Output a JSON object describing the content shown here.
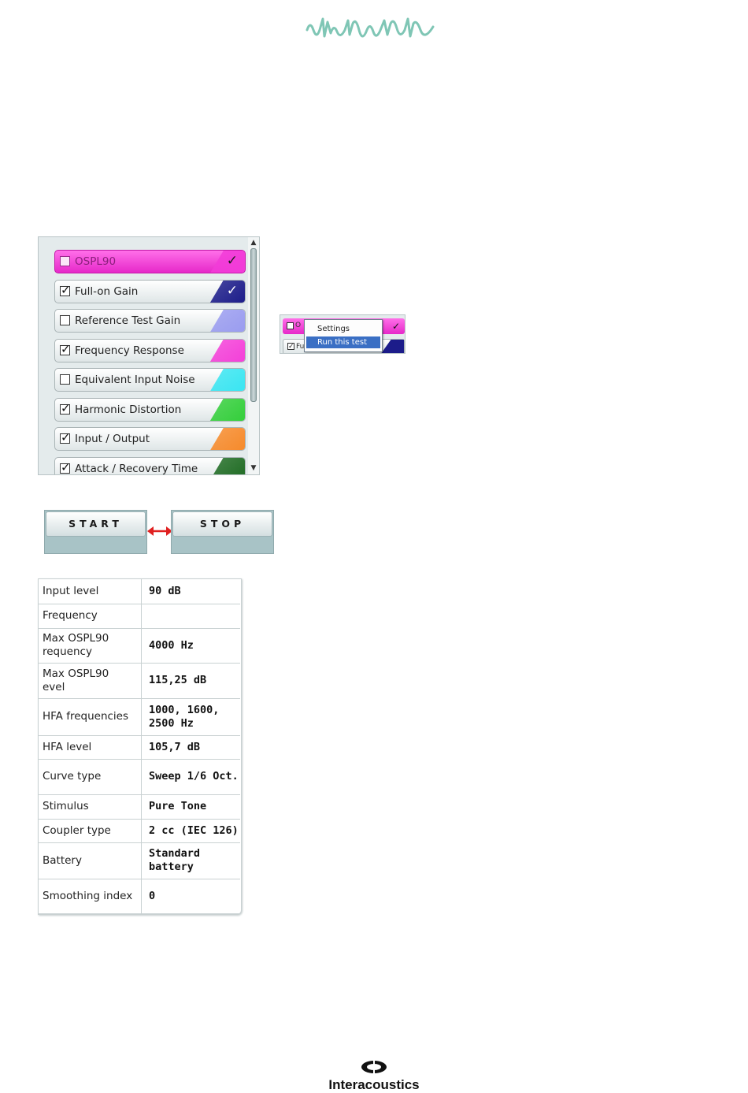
{
  "test_list": {
    "items": [
      {
        "label": "OSPL90",
        "checked": false,
        "active": true,
        "done": true,
        "color": "#f23bd8"
      },
      {
        "label": "Full-on Gain",
        "checked": true,
        "active": false,
        "done": true,
        "color": "#1c1c8a"
      },
      {
        "label": "Reference Test Gain",
        "checked": false,
        "active": false,
        "done": false,
        "color": "#9a9cf0"
      },
      {
        "label": "Frequency Response",
        "checked": true,
        "active": false,
        "done": false,
        "color": "#f53fd9"
      },
      {
        "label": "Equivalent Input Noise",
        "checked": false,
        "active": false,
        "done": false,
        "color": "#39e6f2"
      },
      {
        "label": "Harmonic Distortion",
        "checked": true,
        "active": false,
        "done": false,
        "color": "#33cf3a"
      },
      {
        "label": "Input / Output",
        "checked": true,
        "active": false,
        "done": false,
        "color": "#f78a2a"
      },
      {
        "label": "Attack / Recovery Time",
        "checked": true,
        "active": false,
        "done": false,
        "color": "#1e6b22"
      }
    ]
  },
  "context_menu": {
    "row1_fragment": "O",
    "row2_fragment": "Fu",
    "items": [
      "Settings",
      "Run this test"
    ],
    "selected": "Run this test"
  },
  "controls": {
    "start_label": "START",
    "stop_label": "STOP"
  },
  "results": {
    "rows": [
      {
        "key": "Input level",
        "value": "90 dB"
      },
      {
        "key": "Frequency",
        "value": ""
      },
      {
        "key": "Max OSPL90\nrequency",
        "value": "4000 Hz"
      },
      {
        "key": "Max OSPL90\nevel",
        "value": "115,25 dB"
      },
      {
        "key": "HFA frequencies",
        "value": "1000, 1600,\n2500 Hz"
      },
      {
        "key": "HFA level",
        "value": "105,7 dB"
      },
      {
        "key": "Curve type",
        "value": "Sweep 1/6 Oct."
      },
      {
        "key": "Stimulus",
        "value": "Pure Tone"
      },
      {
        "key": "Coupler type",
        "value": "2 cc (IEC 126)"
      },
      {
        "key": "Battery",
        "value": "Standard\nbattery"
      },
      {
        "key": "Smoothing index",
        "value": "0"
      }
    ]
  },
  "brand": {
    "name": "Interacoustics",
    "logo_color": "#7fc6b5"
  }
}
